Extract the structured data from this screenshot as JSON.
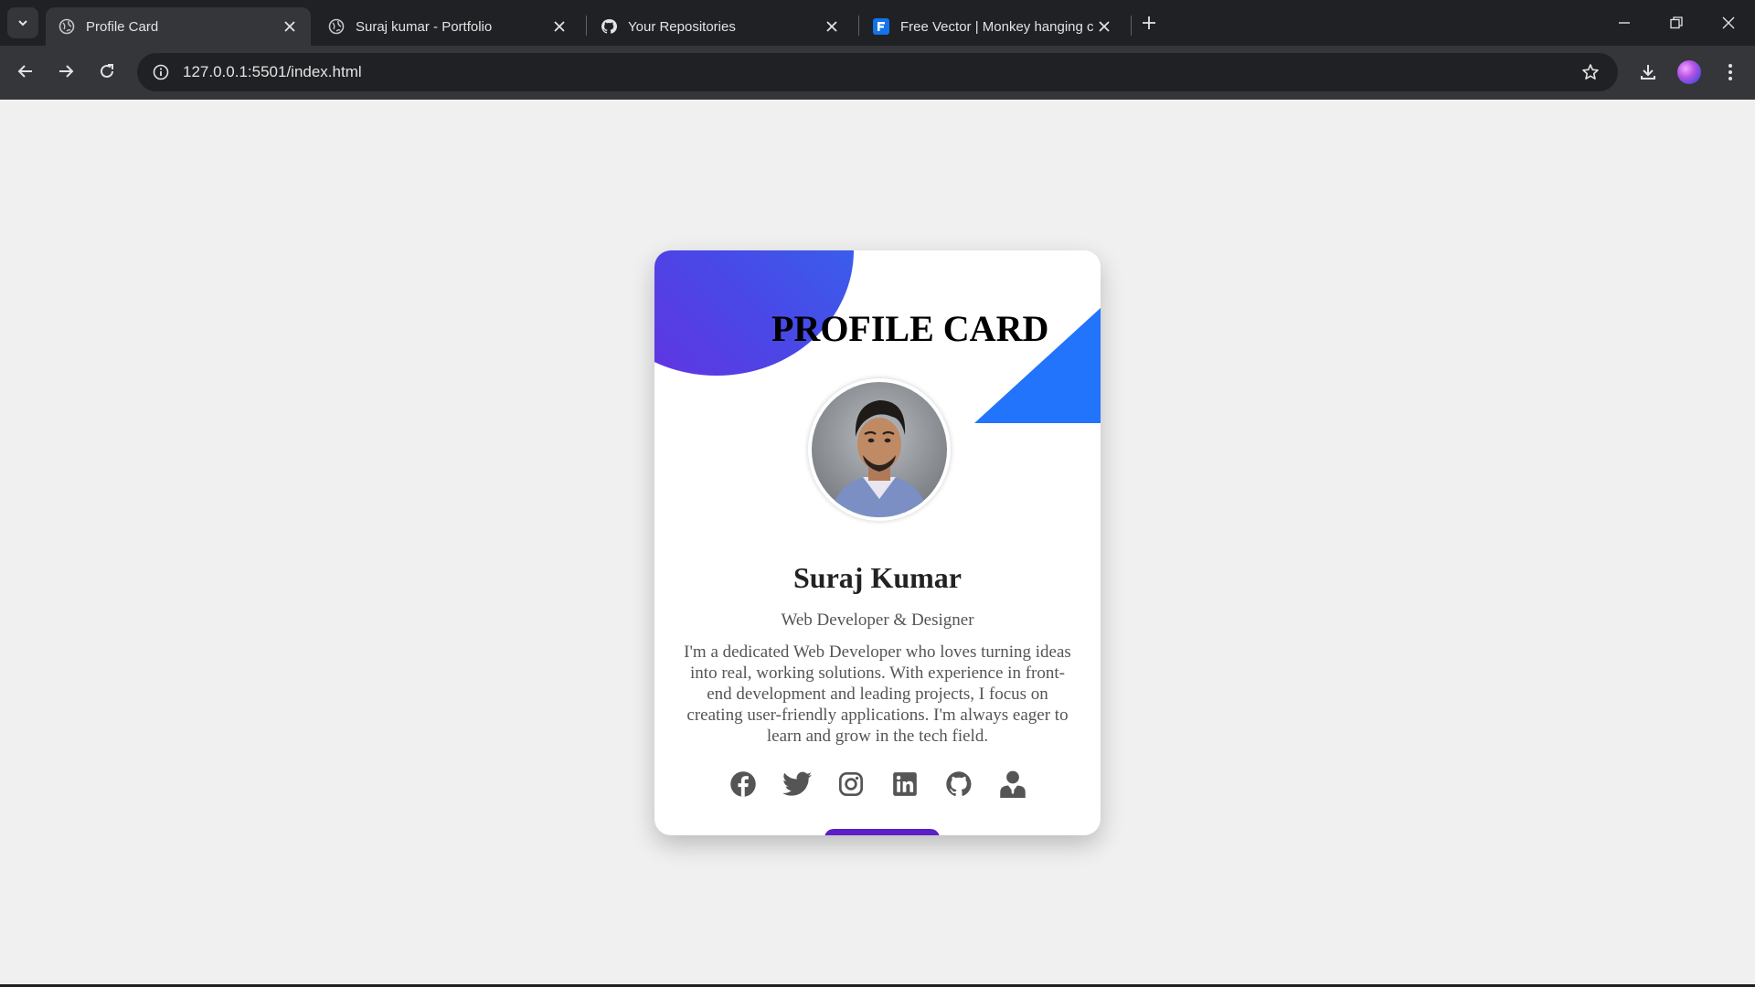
{
  "browser": {
    "tabs": [
      {
        "title": "Profile Card",
        "icon": "globe-icon",
        "active": true
      },
      {
        "title": "Suraj kumar - Portfolio",
        "icon": "globe-icon",
        "active": false
      },
      {
        "title": "Your Repositories",
        "icon": "github-icon",
        "active": false
      },
      {
        "title": "Free Vector | Monkey hanging c",
        "icon": "freepik-icon",
        "active": false
      }
    ],
    "url": "127.0.0.1:5501/index.html"
  },
  "card": {
    "title": "PROFILE CARD",
    "name": "Suraj Kumar",
    "role": "Web Developer & Designer",
    "bio": "I'm a dedicated Web Developer who loves turning ideas into real, working solutions. With experience in front-end development and leading projects, I focus on creating user-friendly applications. I'm always eager to learn and grow in the tech field.",
    "socials": [
      "facebook-icon",
      "twitter-icon",
      "instagram-icon",
      "linkedin-icon",
      "github-icon",
      "profile-icon"
    ],
    "colors": {
      "gradient_start": "#6a2de0",
      "gradient_end": "#2f6df0",
      "triangle": "#2174fb",
      "button": "#5b1ec8"
    }
  }
}
